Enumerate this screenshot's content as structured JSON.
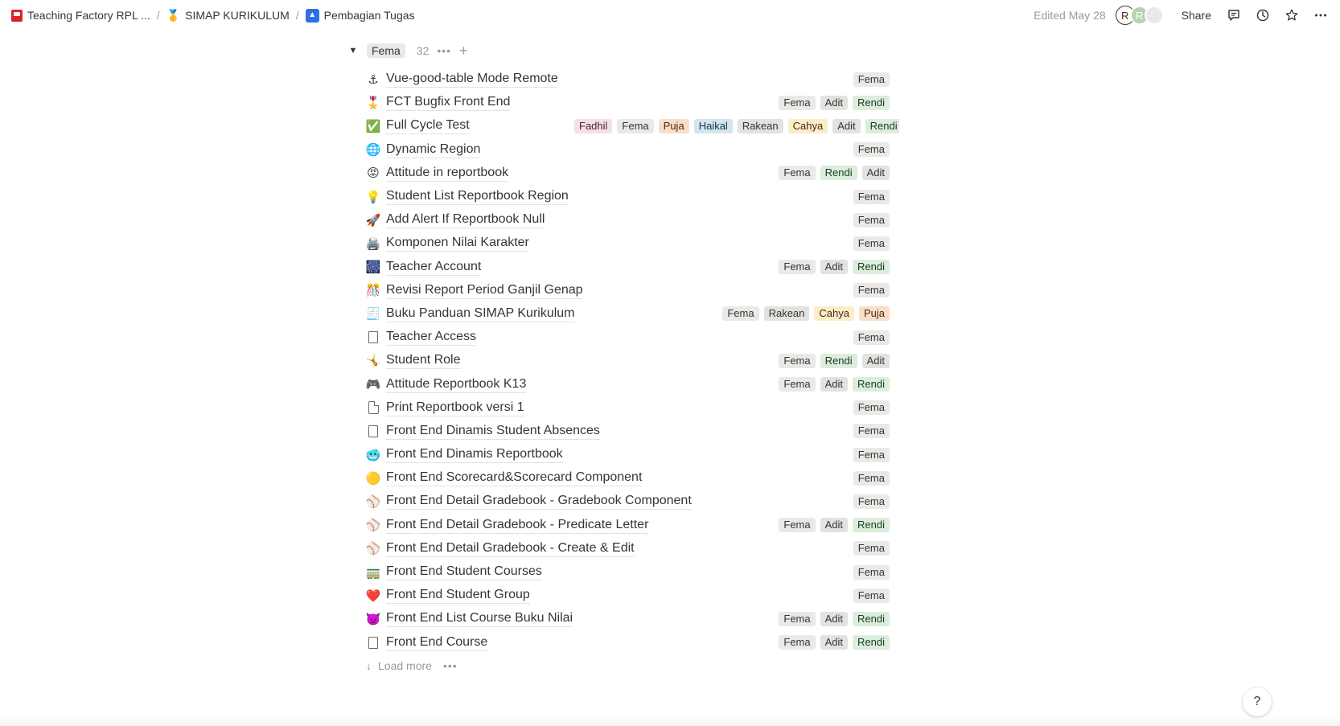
{
  "breadcrumb": [
    {
      "label": "Teaching Factory RPL ...",
      "icon": "book-icon"
    },
    {
      "label": "SIMAP KURIKULUM",
      "icon": "medal-icon"
    },
    {
      "label": "Pembagian Tugas",
      "icon": "triangle-icon"
    }
  ],
  "separator": "/",
  "topbar": {
    "edited": "Edited May 28",
    "avatar_1": "R",
    "avatar_2": "R",
    "share": "Share"
  },
  "group": {
    "name": "Fema",
    "count": "32",
    "more": "•••",
    "add": "+"
  },
  "tag_colors": {
    "Fema": {
      "bg": "#e9e9e7",
      "fg": "#37352f"
    },
    "Adit": {
      "bg": "#e3e2e0",
      "fg": "#37352f"
    },
    "Rendi": {
      "bg": "#dbeddb",
      "fg": "#1c3829"
    },
    "Fadhil": {
      "bg": "#f5e0e9",
      "fg": "#4c2337"
    },
    "Puja": {
      "bg": "#fadec9",
      "fg": "#49290e"
    },
    "Haikal": {
      "bg": "#d3e5ef",
      "fg": "#183347"
    },
    "Rakean": {
      "bg": "#e3e2e0",
      "fg": "#37352f"
    },
    "Cahya": {
      "bg": "#fdecc8",
      "fg": "#402c1b"
    }
  },
  "rows": [
    {
      "icon": "⚓",
      "title": "Vue-good-table Mode Remote",
      "tags": [
        "Fema"
      ]
    },
    {
      "icon": "🎖️",
      "title": "FCT Bugfix Front End",
      "tags": [
        "Fema",
        "Adit",
        "Rendi"
      ]
    },
    {
      "icon": "✅",
      "title": "Full Cycle Test",
      "tags": [
        "Fadhil",
        "Fema",
        "Puja",
        "Haikal",
        "Rakean",
        "Cahya",
        "Adit",
        "Rendi"
      ]
    },
    {
      "icon": "🌐",
      "title": "Dynamic Region",
      "tags": [
        "Fema"
      ]
    },
    {
      "icon": "😡",
      "title": "Attitude in reportbook",
      "tags": [
        "Fema",
        "Rendi",
        "Adit"
      ]
    },
    {
      "icon": "💡",
      "title": "Student List Reportbook Region",
      "tags": [
        "Fema"
      ]
    },
    {
      "icon": "🚀",
      "title": "Add Alert If Reportbook Null",
      "tags": [
        "Fema"
      ]
    },
    {
      "icon": "🖨️",
      "title": "Komponen Nilai Karakter",
      "tags": [
        "Fema"
      ]
    },
    {
      "icon": "🎆",
      "title": "Teacher Account",
      "tags": [
        "Fema",
        "Adit",
        "Rendi"
      ]
    },
    {
      "icon": "🎊",
      "title": "Revisi Report Period Ganjil Genap",
      "tags": [
        "Fema"
      ]
    },
    {
      "icon": "🧾",
      "title": "Buku Panduan SIMAP Kurikulum",
      "tags": [
        "Fema",
        "Rakean",
        "Cahya",
        "Puja"
      ]
    },
    {
      "icon": "page",
      "title": "Teacher Access",
      "tags": [
        "Fema"
      ]
    },
    {
      "icon": "🤸",
      "title": "Student Role",
      "tags": [
        "Fema",
        "Rendi",
        "Adit"
      ]
    },
    {
      "icon": "🎮",
      "title": "Attitude Reportbook K13",
      "tags": [
        "Fema",
        "Adit",
        "Rendi"
      ]
    },
    {
      "icon": "doc",
      "title": "Print Reportbook versi 1",
      "tags": [
        "Fema"
      ]
    },
    {
      "icon": "page",
      "title": "Front End Dinamis Student Absences",
      "tags": [
        "Fema"
      ]
    },
    {
      "icon": "🥶",
      "title": "Front End Dinamis Reportbook",
      "tags": [
        "Fema"
      ]
    },
    {
      "icon": "🟡",
      "title": "Front End Scorecard&Scorecard Component",
      "tags": [
        "Fema"
      ]
    },
    {
      "icon": "⚾",
      "title": "Front End Detail Gradebook - Gradebook Component",
      "tags": [
        "Fema"
      ]
    },
    {
      "icon": "⚾",
      "title": "Front End Detail Gradebook - Predicate Letter",
      "tags": [
        "Fema",
        "Adit",
        "Rendi"
      ]
    },
    {
      "icon": "⚾",
      "title": "Front End Detail Gradebook - Create & Edit",
      "tags": [
        "Fema"
      ]
    },
    {
      "icon": "🚃",
      "title": "Front End Student Courses",
      "tags": [
        "Fema"
      ]
    },
    {
      "icon": "❤️",
      "title": "Front End Student Group",
      "tags": [
        "Fema"
      ]
    },
    {
      "icon": "👿",
      "title": "Front End List Course Buku Nilai",
      "tags": [
        "Fema",
        "Adit",
        "Rendi"
      ]
    },
    {
      "icon": "page",
      "title": "Front End Course",
      "tags": [
        "Fema",
        "Adit",
        "Rendi"
      ]
    }
  ],
  "load_more": {
    "label": "Load more",
    "more": "•••"
  },
  "help": "?"
}
